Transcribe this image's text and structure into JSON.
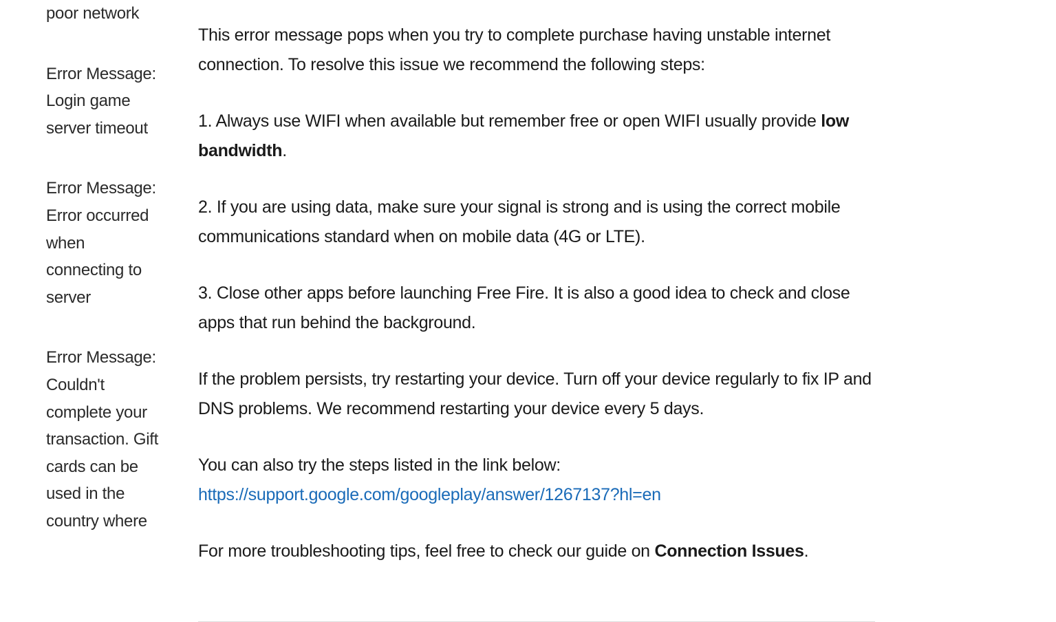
{
  "sidebar": {
    "items": [
      {
        "label": "poor network"
      },
      {
        "label": "Error Message: Login game server timeout"
      },
      {
        "label": "Error Message: Error occurred when connecting to server"
      },
      {
        "label": "Error Message: Couldn't complete your transaction. Gift cards can be used in the country where"
      }
    ]
  },
  "main": {
    "intro": "This error message pops when you try to complete purchase having unstable internet connection. To resolve this issue we recommend the following steps:",
    "step1_prefix": "1. Always use WIFI when available but remember free or open WIFI usually provide ",
    "step1_bold": "low bandwidth",
    "step1_suffix": ".",
    "step2": "2. If you are using data, make sure your signal is strong and is using the correct mobile communications standard when on mobile data (4G or LTE).",
    "step3": "3. Close other apps before launching Free Fire. It is also a good idea to check and close apps that run behind the background.",
    "restart": "If the problem persists, try restarting your device. Turn off your device regularly to fix IP and DNS problems. We recommend restarting your device every 5 days.",
    "link_intro": "You can also try the steps listed in the link below:",
    "link_url": "https://support.google.com/googleplay/answer/1267137?hl=en",
    "more_prefix": "For more troubleshooting tips, feel free to check our guide on ",
    "more_bold": "Connection Issues",
    "more_suffix": "."
  }
}
